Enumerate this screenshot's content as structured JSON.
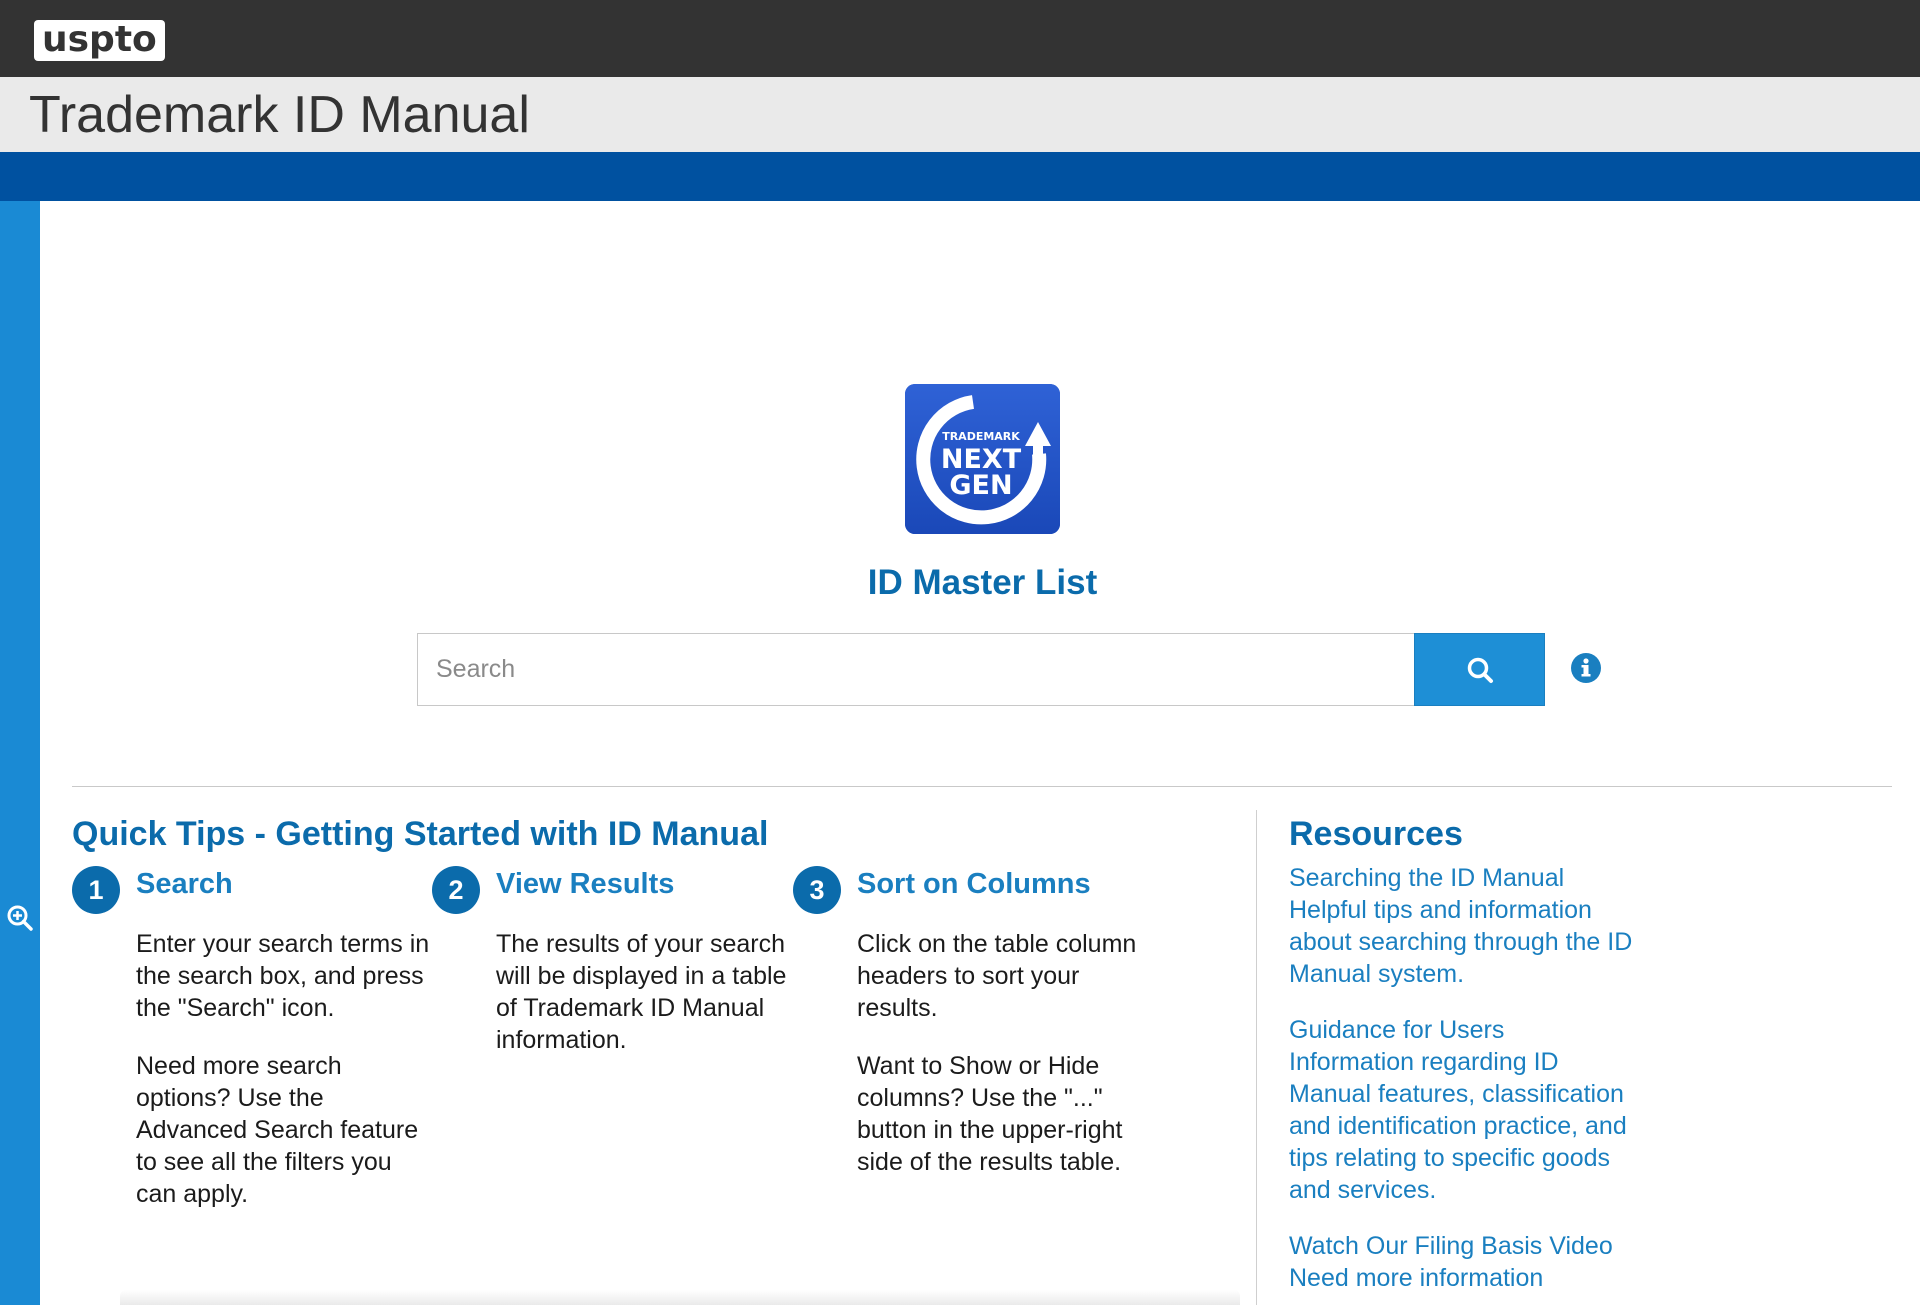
{
  "header": {
    "logo_text": "uspto",
    "app_title": "Trademark ID Manual"
  },
  "hero": {
    "logo_lines": [
      "TRADEMARK",
      "NEXT",
      "GEN"
    ],
    "title": "ID Master List"
  },
  "search": {
    "placeholder": "Search",
    "value": ""
  },
  "icons": {
    "sidebar_toggle": "zoom-in-icon",
    "search_button": "search-icon",
    "info": "info-icon"
  },
  "colors": {
    "topbar": "#333333",
    "brand_blue": "#0051a0",
    "side_strip": "#1a8ad4",
    "accent": "#0b6bab",
    "search_button": "#1e8fd6"
  },
  "quick_tips": {
    "title": "Quick Tips - Getting Started with ID Manual",
    "steps": [
      {
        "number": "1",
        "heading": "Search",
        "paragraphs": [
          "Enter your search terms in the search box, and press the \"Search\" icon.",
          "Need more search options? Use the Advanced Search feature to see all the filters you can apply."
        ]
      },
      {
        "number": "2",
        "heading": "View Results",
        "paragraphs": [
          "The results of your search will be displayed in a table of Trademark ID Manual information."
        ]
      },
      {
        "number": "3",
        "heading": "Sort on Columns",
        "paragraphs": [
          "Click on the table column headers to sort your results.",
          "Want to Show or Hide columns? Use the \"...\" button in the upper-right side of the results table."
        ]
      }
    ]
  },
  "resources": {
    "title": "Resources",
    "items": [
      {
        "link": "Searching the ID Manual",
        "description": "Helpful tips and information about searching through the ID Manual system."
      },
      {
        "link": "Guidance for Users",
        "description": "Information regarding ID Manual features, classification and identification practice, and tips relating to specific goods and services."
      },
      {
        "link": "Watch Our Filing Basis Video",
        "description": "Need more information"
      }
    ]
  }
}
